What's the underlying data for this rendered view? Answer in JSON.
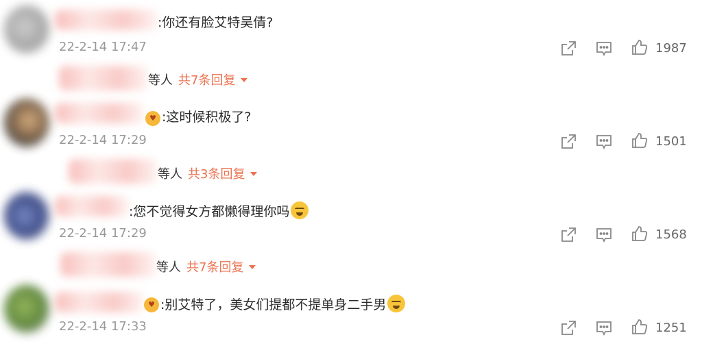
{
  "comments": [
    {
      "text": ":你还有脸艾特吴倩?",
      "time": "22-2-14 17:47",
      "likes": "1987",
      "replies_prefix": "等人",
      "replies_label": "共7条回复"
    },
    {
      "text": ":这时候积极了?",
      "time": "22-2-14 17:29",
      "likes": "1501",
      "replies_prefix": "等人",
      "replies_label": "共3条回复"
    },
    {
      "text": ":您不觉得女方都懒得理你吗",
      "time": "22-2-14 17:29",
      "likes": "1568",
      "replies_prefix": "等人",
      "replies_label": "共7条回复"
    },
    {
      "text": ":别艾特了，美女们提都不提单身二手男",
      "time": "22-2-14 17:33",
      "likes": "1251"
    }
  ],
  "colors": {
    "accent": "#eb7350",
    "timestamp": "#999999",
    "icon": "#888888"
  },
  "icons": [
    "share-icon",
    "comment-icon",
    "like-icon",
    "dropdown-caret-icon"
  ]
}
